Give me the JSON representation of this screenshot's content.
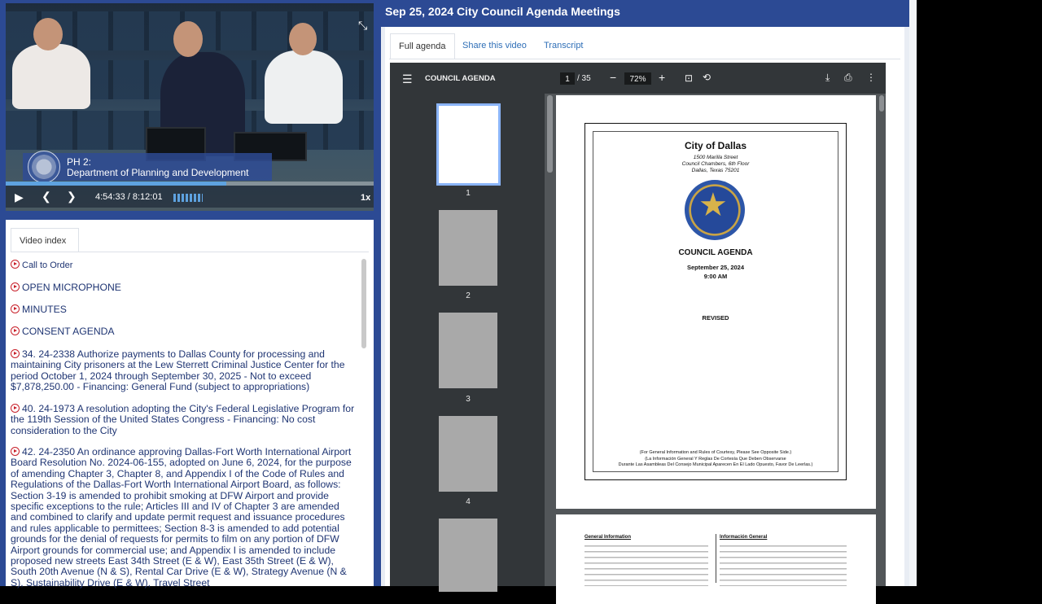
{
  "header": {
    "title": "Sep 25, 2024 City Council Agenda Meetings"
  },
  "tabs": [
    {
      "label": "Full agenda",
      "active": true
    },
    {
      "label": "Share this video",
      "active": false
    },
    {
      "label": "Transcript",
      "active": false
    }
  ],
  "video": {
    "lower_third_line1": "PH 2:",
    "lower_third_line2": "Department of Planning and Development",
    "time": "4:54:33 / 8:12:01",
    "speed": "1x",
    "progress_fraction": 0.6
  },
  "video_index": {
    "tab_label": "Video index",
    "items": [
      {
        "text": "Call to Order",
        "size": "small"
      },
      {
        "text": "OPEN MICROPHONE",
        "size": "big"
      },
      {
        "text": "MINUTES",
        "size": "big"
      },
      {
        "text": "CONSENT AGENDA",
        "size": "big"
      },
      {
        "text": "34. 24-2338 Authorize payments to Dallas County for processing and maintaining City prisoners at the Lew Sterrett Criminal Justice Center for the period October 1, 2024 through September 30, 2025 - Not to exceed $7,878,250.00 - Financing: General Fund (subject to appropriations)",
        "size": "big"
      },
      {
        "text": "40. 24-1973 A resolution adopting the City's Federal Legislative Program for the 119th Session of the United States Congress - Financing: No cost consideration to the City",
        "size": "big"
      },
      {
        "text": "42. 24-2350 An ordinance approving Dallas-Fort Worth International Airport Board Resolution No. 2024-06-155, adopted on June 6, 2024, for the purpose of amending Chapter 3, Chapter 8, and Appendix I of the Code of Rules and Regulations of the Dallas-Fort Worth International Airport Board, as follows: Section 3-19 is amended to prohibit smoking at DFW Airport and provide specific exceptions to the rule; Articles III and IV of Chapter 3 are amended and combined to clarify and update permit request and issuance procedures and rules applicable to permittees; Section 8-3 is amended to add potential grounds for the denial of requests for permits to film on any portion of DFW Airport grounds for commercial use; and Appendix I is amended to include proposed new streets East 34th Street (E & W), East 35th Street (E & W), South 20th Avenue (N & S), Rental Car Drive (E & W), Strategy Avenue (N & S), Sustainability Drive (E & W), Travel Street",
        "size": "big"
      }
    ]
  },
  "pdf": {
    "doc_title": "COUNCIL AGENDA",
    "page_current": "1",
    "page_total": "/ 35",
    "zoom": "72%",
    "thumb_numbers": [
      "1",
      "2",
      "3",
      "4"
    ],
    "page1": {
      "city": "City of Dallas",
      "address1": "1500 Marilla Street",
      "address2": "Council Chambers, 6th Floor",
      "address3": "Dallas, Texas 75201",
      "heading": "COUNCIL AGENDA",
      "date": "September 25, 2024",
      "time": "9:00 AM",
      "status": "REVISED",
      "footer1": "(For General Information and Rules of Courtesy, Please See Opposite Side.)",
      "footer2": "(La Información General Y Reglas De Cortesía Que Deben Observarse",
      "footer3": "Durante Las Asambleas Del Consejo Municipal Aparecen En El Lado Opuesto, Favor De Leerlas.)"
    },
    "page2": {
      "left_heading": "General Information",
      "right_heading": "Información General"
    }
  }
}
